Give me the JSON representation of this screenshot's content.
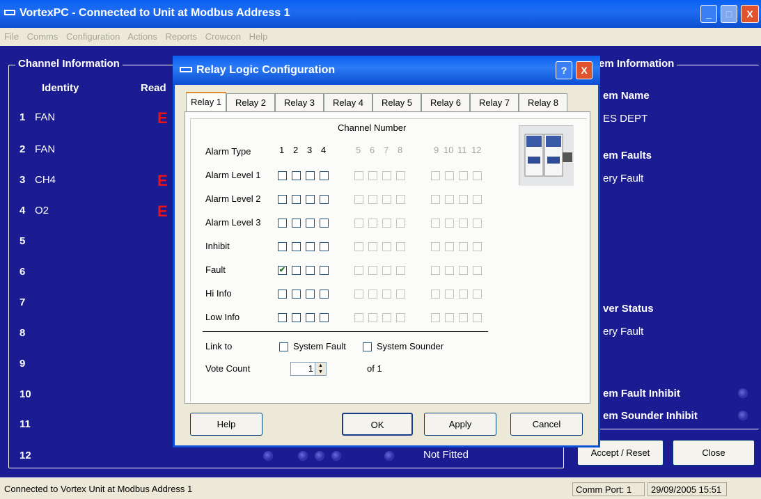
{
  "window": {
    "title": "VortexPC - Connected to Unit at Modbus Address 1",
    "minimize_glyph": "_",
    "maximize_glyph": "□",
    "close_glyph": "X"
  },
  "menu": [
    "File",
    "Comms",
    "Configuration",
    "Actions",
    "Reports",
    "Crowcon",
    "Help"
  ],
  "channel_panel": {
    "group_label": "Channel Information",
    "identity_header": "Identity",
    "reading_header": "Read",
    "error_mark": "E",
    "rows": [
      {
        "num": "1",
        "id": "FAN"
      },
      {
        "num": "2",
        "id": "FAN"
      },
      {
        "num": "3",
        "id": "CH4"
      },
      {
        "num": "4",
        "id": "O2"
      },
      {
        "num": "5",
        "id": ""
      },
      {
        "num": "6",
        "id": ""
      },
      {
        "num": "7",
        "id": ""
      },
      {
        "num": "8",
        "id": ""
      },
      {
        "num": "9",
        "id": ""
      },
      {
        "num": "10",
        "id": ""
      },
      {
        "num": "11",
        "id": ""
      },
      {
        "num": "12",
        "id": ""
      }
    ],
    "row12_status": "Not Fitted"
  },
  "system_panel": {
    "group_label": "em Information",
    "name_label": "em Name",
    "name_value": "ES DEPT",
    "faults_label": "em Faults",
    "faults_value": "ery Fault",
    "power_label": "ver Status",
    "power_value": "ery Fault",
    "fault_inhibit_label": "em Fault Inhibit",
    "sounder_inhibit_label": "em Sounder Inhibit"
  },
  "main_buttons": {
    "accept_reset": "Accept / Reset",
    "close": "Close"
  },
  "statusbar": {
    "message": "Connected to Vortex Unit at Modbus Address 1",
    "comm_port": "Comm Port: 1",
    "datetime": "29/09/2005 15:51"
  },
  "dialog": {
    "title": "Relay Logic Configuration",
    "help_glyph": "?",
    "close_glyph": "X",
    "tabs": [
      "Relay 1",
      "Relay 2",
      "Relay 3",
      "Relay 4",
      "Relay 5",
      "Relay 6",
      "Relay 7",
      "Relay 8"
    ],
    "active_tab": "Relay 1",
    "channel_number_label": "Channel Number",
    "alarm_type_label": "Alarm Type",
    "channels": [
      "1",
      "2",
      "3",
      "4",
      "5",
      "6",
      "7",
      "8",
      "9",
      "10",
      "11",
      "12"
    ],
    "rows": [
      {
        "label": "Alarm Level 1",
        "checked": [
          false,
          false,
          false,
          false
        ]
      },
      {
        "label": "Alarm Level 2",
        "checked": [
          false,
          false,
          false,
          false
        ]
      },
      {
        "label": "Alarm Level 3",
        "checked": [
          false,
          false,
          false,
          false
        ]
      },
      {
        "label": "Inhibit",
        "checked": [
          false,
          false,
          false,
          false
        ]
      },
      {
        "label": "Fault",
        "checked": [
          true,
          false,
          false,
          false
        ]
      },
      {
        "label": "Hi Info",
        "checked": [
          false,
          false,
          false,
          false
        ]
      },
      {
        "label": "Low Info",
        "checked": [
          false,
          false,
          false,
          false
        ]
      }
    ],
    "link_to_label": "Link to",
    "system_fault_label": "System Fault",
    "system_sounder_label": "System Sounder",
    "vote_count_label": "Vote Count",
    "vote_count_value": "1",
    "vote_of_label": "of 1",
    "buttons": {
      "help": "Help",
      "ok": "OK",
      "apply": "Apply",
      "cancel": "Cancel"
    }
  }
}
